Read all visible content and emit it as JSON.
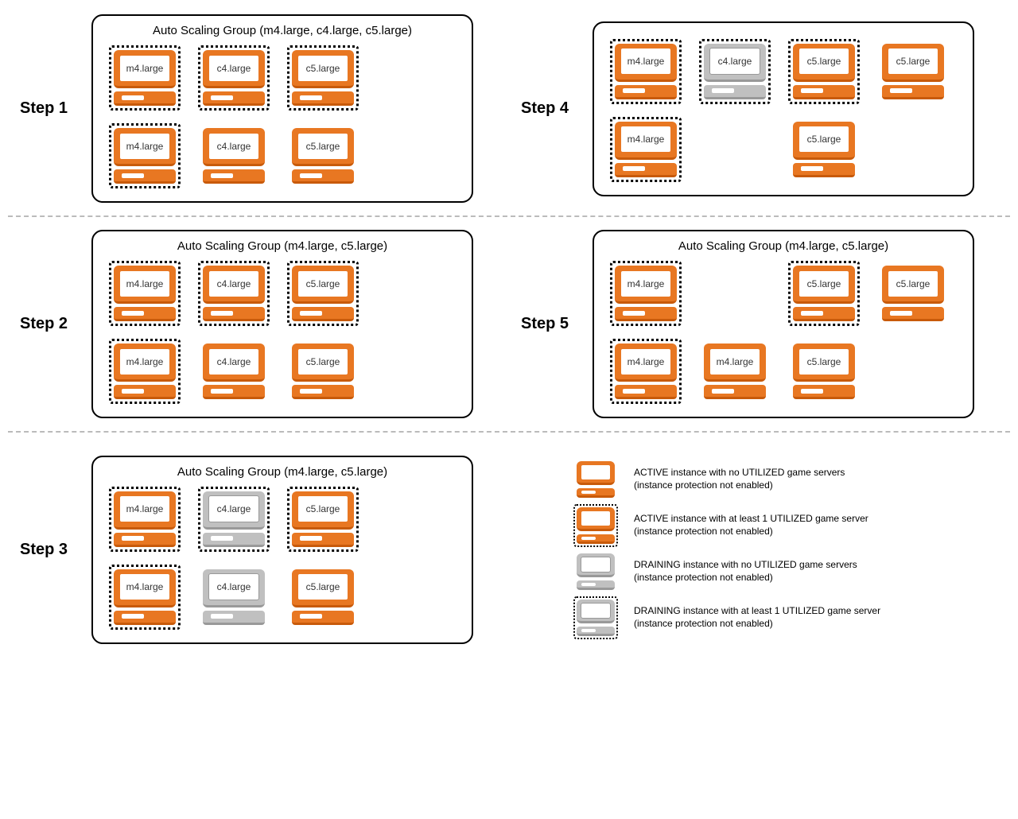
{
  "steps": [
    {
      "id": 1,
      "label": "Step 1",
      "title": "Auto Scaling Group (m4.large, c4.large, c5.large)",
      "instances": [
        {
          "label": "m4.large",
          "color": "orange",
          "dotted": true
        },
        {
          "label": "c4.large",
          "color": "orange",
          "dotted": true
        },
        {
          "label": "c5.large",
          "color": "orange",
          "dotted": true
        },
        null,
        {
          "label": "m4.large",
          "color": "orange",
          "dotted": true
        },
        {
          "label": "c4.large",
          "color": "orange",
          "dotted": false
        },
        {
          "label": "c5.large",
          "color": "orange",
          "dotted": false
        },
        null
      ]
    },
    {
      "id": 4,
      "label": "Step 4",
      "title": "",
      "instances": [
        {
          "label": "m4.large",
          "color": "orange",
          "dotted": true
        },
        {
          "label": "c4.large",
          "color": "grey",
          "dotted": true
        },
        {
          "label": "c5.large",
          "color": "orange",
          "dotted": true
        },
        {
          "label": "c5.large",
          "color": "orange",
          "dotted": false
        },
        {
          "label": "m4.large",
          "color": "orange",
          "dotted": true
        },
        null,
        {
          "label": "c5.large",
          "color": "orange",
          "dotted": false
        },
        null
      ]
    },
    {
      "id": 2,
      "label": "Step 2",
      "title": "Auto Scaling Group (m4.large, c5.large)",
      "instances": [
        {
          "label": "m4.large",
          "color": "orange",
          "dotted": true
        },
        {
          "label": "c4.large",
          "color": "orange",
          "dotted": true
        },
        {
          "label": "c5.large",
          "color": "orange",
          "dotted": true
        },
        null,
        {
          "label": "m4.large",
          "color": "orange",
          "dotted": true
        },
        {
          "label": "c4.large",
          "color": "orange",
          "dotted": false
        },
        {
          "label": "c5.large",
          "color": "orange",
          "dotted": false
        },
        null
      ]
    },
    {
      "id": 5,
      "label": "Step 5",
      "title": "Auto Scaling Group (m4.large, c5.large)",
      "instances": [
        {
          "label": "m4.large",
          "color": "orange",
          "dotted": true
        },
        null,
        {
          "label": "c5.large",
          "color": "orange",
          "dotted": true
        },
        {
          "label": "c5.large",
          "color": "orange",
          "dotted": false
        },
        {
          "label": "m4.large",
          "color": "orange",
          "dotted": true
        },
        {
          "label": "m4.large",
          "color": "orange",
          "dotted": false
        },
        {
          "label": "c5.large",
          "color": "orange",
          "dotted": false
        },
        null
      ]
    },
    {
      "id": 3,
      "label": "Step 3",
      "title": "Auto Scaling Group (m4.large, c5.large)",
      "instances": [
        {
          "label": "m4.large",
          "color": "orange",
          "dotted": true
        },
        {
          "label": "c4.large",
          "color": "grey",
          "dotted": true
        },
        {
          "label": "c5.large",
          "color": "orange",
          "dotted": true
        },
        null,
        {
          "label": "m4.large",
          "color": "orange",
          "dotted": true
        },
        {
          "label": "c4.large",
          "color": "grey",
          "dotted": false
        },
        {
          "label": "c5.large",
          "color": "orange",
          "dotted": false
        },
        null
      ]
    }
  ],
  "legend": [
    {
      "color": "orange",
      "dotted": false,
      "text": "ACTIVE instance with no UTILIZED game servers\n(instance protection not enabled)"
    },
    {
      "color": "orange",
      "dotted": true,
      "text": "ACTIVE instance with at least 1 UTILIZED game server\n(instance protection not enabled)"
    },
    {
      "color": "grey",
      "dotted": false,
      "text": "DRAINING instance with no UTILIZED game servers\n(instance protection not enabled)"
    },
    {
      "color": "grey",
      "dotted": true,
      "text": "DRAINING instance with at least 1 UTILIZED game server\n(instance protection not enabled)"
    }
  ]
}
